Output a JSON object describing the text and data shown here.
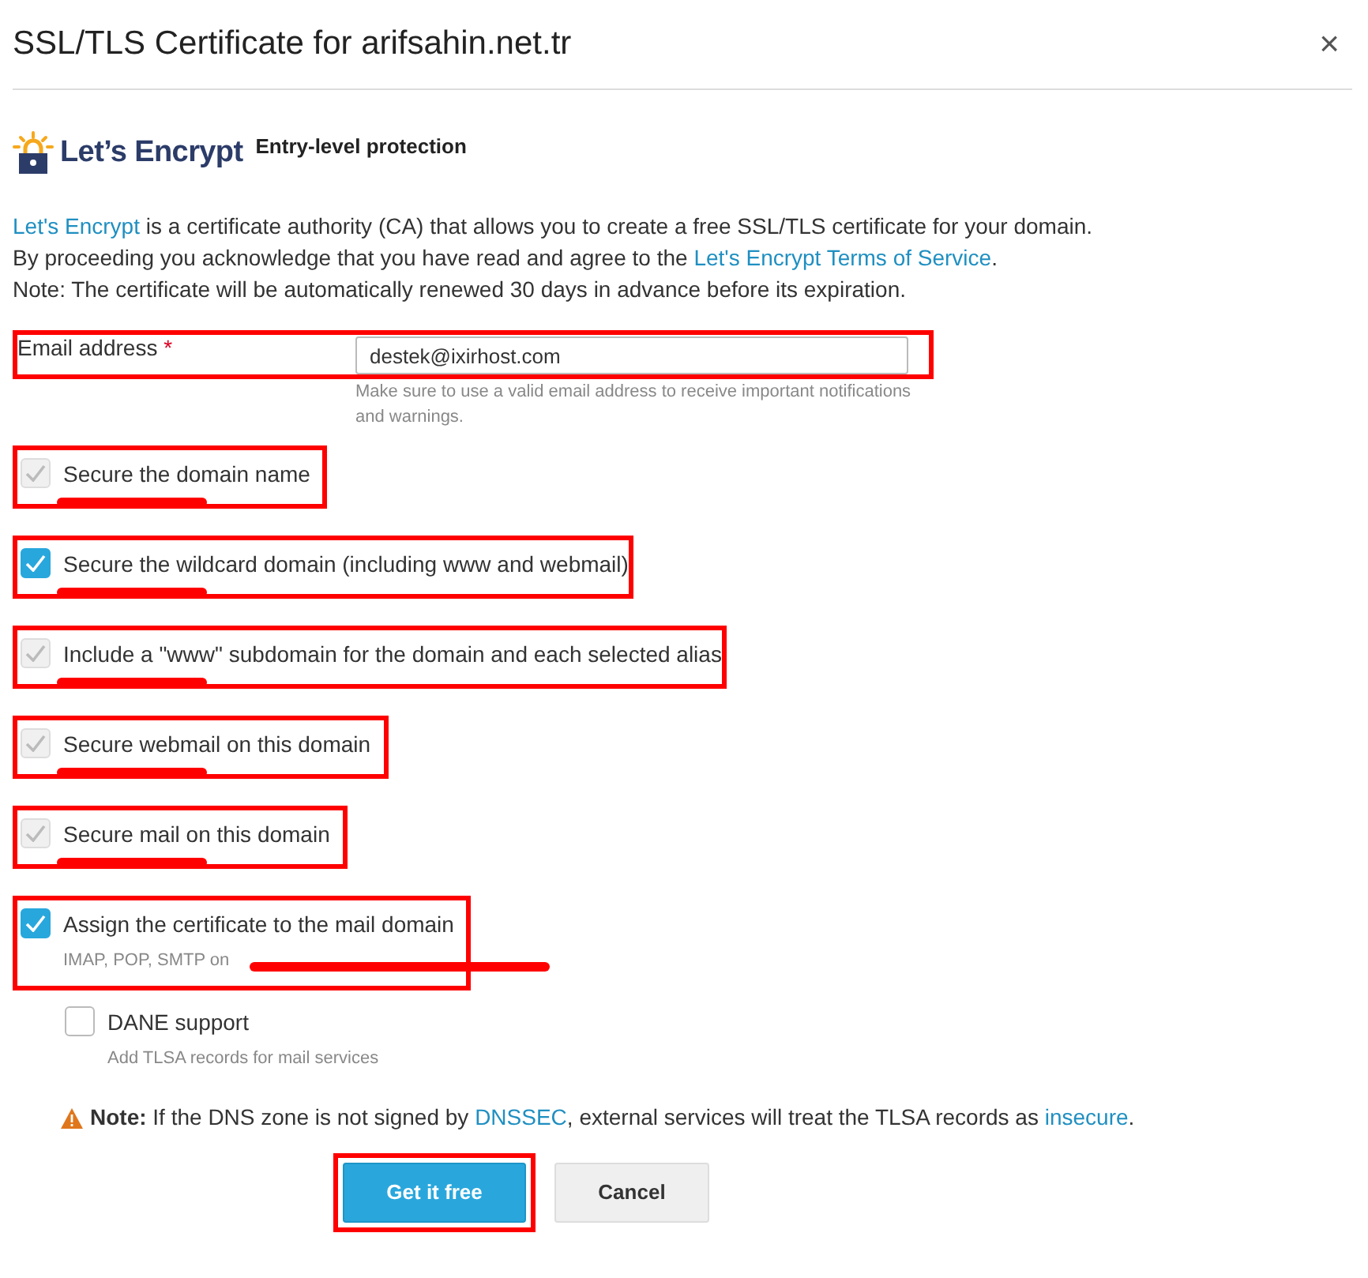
{
  "dialog": {
    "title": "SSL/TLS Certificate for arifsahin.net.tr",
    "close": "×"
  },
  "provider": {
    "logo_text": "Let’s Encrypt",
    "tagline": "Entry-level protection"
  },
  "intro": [
    [
      {
        "text": "Let's Encrypt",
        "link": true
      },
      {
        "text": " is a certificate authority (CA) that allows you to create a free SSL/TLS certificate for your domain.",
        "link": false
      }
    ],
    [
      {
        "text": "By proceeding you acknowledge that you have read and agree to the ",
        "link": false
      },
      {
        "text": "Let's Encrypt Terms of Service",
        "link": true
      },
      {
        "text": ".",
        "link": false
      }
    ],
    [
      {
        "text": "Note: The certificate will be automatically renewed 30 days in advance before its expiration.",
        "link": false
      }
    ]
  ],
  "email": {
    "label": "Email address",
    "required_mark": "*",
    "value": "destek@ixirhost.com",
    "hint": "Make sure to use a valid email address to receive important notifications and warnings.",
    "highlighted": true
  },
  "options": [
    {
      "label": "Secure the domain name",
      "checked": true,
      "disabled": true,
      "highlighted": true,
      "redacted": true
    },
    {
      "label": "Secure the wildcard domain (including www and webmail)",
      "checked": true,
      "disabled": false,
      "highlighted": true,
      "redacted": true
    },
    {
      "label": "Include a \"www\" subdomain for the domain and each selected alias",
      "checked": true,
      "disabled": true,
      "highlighted": true,
      "redacted": true
    },
    {
      "label": "Secure webmail on this domain",
      "checked": true,
      "disabled": true,
      "highlighted": true,
      "redacted": true
    },
    {
      "label": "Secure mail on this domain",
      "checked": true,
      "disabled": true,
      "highlighted": true,
      "redacted": true
    },
    {
      "label": "Assign the certificate to the mail domain",
      "hint": "IMAP, POP, SMTP on",
      "checked": true,
      "disabled": false,
      "highlighted": true,
      "redacted": true,
      "children": [
        {
          "label": "DANE support",
          "hint": "Add TLSA records for mail services",
          "checked": false,
          "disabled": false,
          "highlighted": false,
          "redacted": false
        }
      ]
    }
  ],
  "note": [
    {
      "text": "Note:",
      "kind": "bold"
    },
    {
      "text": " If the DNS zone is not signed by ",
      "kind": "plain"
    },
    {
      "text": "DNSSEC",
      "kind": "link"
    },
    {
      "text": ", external services will treat the TLSA records as ",
      "kind": "plain"
    },
    {
      "text": "insecure",
      "kind": "link"
    },
    {
      "text": ".",
      "kind": "plain"
    }
  ],
  "buttons": [
    {
      "label": "Get it free",
      "kind": "primary",
      "highlighted": true
    },
    {
      "label": "Cancel",
      "kind": "secondary",
      "highlighted": false
    }
  ]
}
